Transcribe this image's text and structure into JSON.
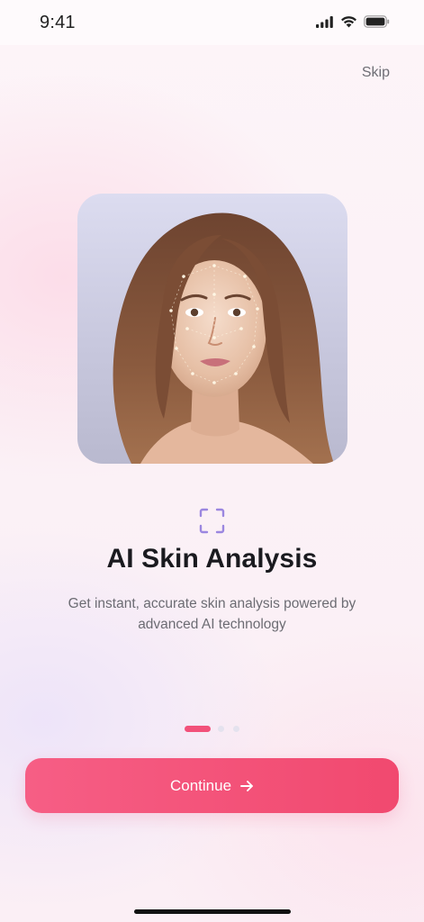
{
  "status_bar": {
    "time": "9:41",
    "icons": [
      "cellular-signal-icon",
      "wifi-icon",
      "battery-icon"
    ]
  },
  "header": {
    "skip_label": "Skip"
  },
  "hero": {
    "image": "woman-portrait-with-face-scan-points"
  },
  "feature": {
    "icon": "scan-icon",
    "title": "AI Skin Analysis",
    "description": "Get instant, accurate skin analysis powered by advanced AI technology"
  },
  "pagination": {
    "current": 1,
    "total": 3
  },
  "footer": {
    "continue_label": "Continue",
    "continue_icon": "arrow-right-icon"
  },
  "colors": {
    "accent": "#f2517a",
    "scan_icon": "#9b87e0",
    "text_primary": "#1a1a1f",
    "text_secondary": "#6c6c73"
  }
}
